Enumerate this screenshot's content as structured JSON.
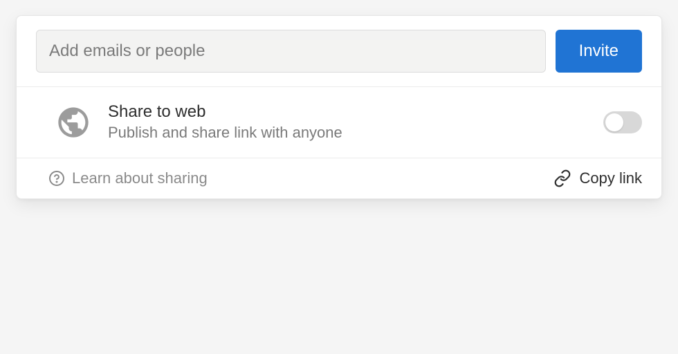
{
  "invite": {
    "placeholder": "Add emails or people",
    "button_label": "Invite"
  },
  "share_web": {
    "title": "Share to web",
    "subtitle": "Publish and share link with anyone",
    "toggle_on": false
  },
  "footer": {
    "learn_label": "Learn about sharing",
    "copy_label": "Copy link"
  }
}
